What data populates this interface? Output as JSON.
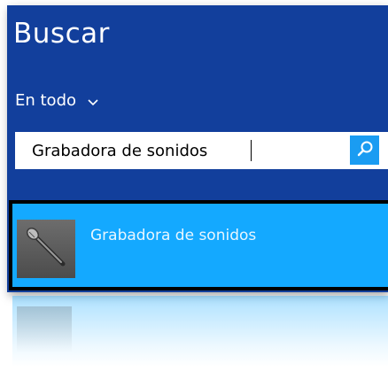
{
  "search_panel": {
    "title": "Buscar",
    "scope_label": "En todo",
    "scope_icon": "chevron-down-icon",
    "search_value": "Grabadora de sonidos",
    "search_button_icon": "search-icon"
  },
  "results": {
    "items": [
      {
        "label": "Grabadora de sonidos",
        "icon": "microphone-icon"
      }
    ]
  },
  "colors": {
    "pane_background": "#123f9c",
    "selection_background": "#14a9ff",
    "search_button": "#1a9cf2",
    "selection_border": "#000000"
  }
}
